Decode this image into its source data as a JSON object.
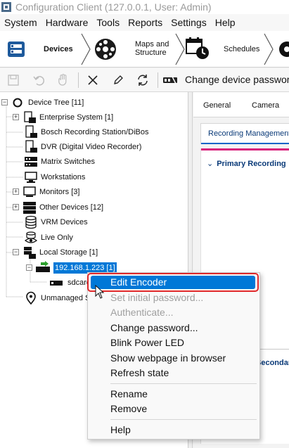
{
  "window": {
    "title": "Configuration Client (127.0.0.1, User: Admin)"
  },
  "menu": [
    "System",
    "Hardware",
    "Tools",
    "Reports",
    "Settings",
    "Help"
  ],
  "workflow": {
    "devices": "Devices",
    "maps_line1": "Maps and",
    "maps_line2": "Structure",
    "schedules": "Schedules"
  },
  "toolbar": {
    "change_password": "Change device password"
  },
  "tree": {
    "root": "Device Tree [11]",
    "items": [
      "Enterprise System [1]",
      "Bosch Recording Station/DiBos",
      "DVR (Digital Video Recorder)",
      "Matrix Switches",
      "Workstations",
      "Monitors [3]",
      "Other Devices [12]",
      "VRM Devices",
      "Live Only",
      "Local Storage [1]"
    ],
    "selected_encoder": "192.168.1.223 [1]",
    "sdcard": "sdcard",
    "unmanaged": "Unmanaged Sites"
  },
  "right_panel": {
    "tabs": [
      "General",
      "Camera"
    ],
    "subtab": "Recording Management",
    "section": "Primary Recording",
    "section2": "Secondary Recording"
  },
  "context_menu": {
    "items": [
      {
        "label": "Edit Encoder",
        "state": "highlighted"
      },
      {
        "label": "Set initial password...",
        "state": "disabled"
      },
      {
        "label": "Authenticate...",
        "state": "disabled"
      },
      {
        "label": "Change password...",
        "state": "enabled"
      },
      {
        "label": "Blink Power LED",
        "state": "enabled"
      },
      {
        "label": "Show webpage in browser",
        "state": "enabled"
      },
      {
        "label": "Refresh state",
        "state": "enabled"
      },
      {
        "label": "Rename",
        "state": "enabled"
      },
      {
        "label": "Remove",
        "state": "enabled"
      },
      {
        "label": "Help",
        "state": "enabled"
      }
    ]
  },
  "colors": {
    "selection": "#0078d7",
    "highlight_box": "#e0282a",
    "accent_pink": "#d81b7a"
  }
}
